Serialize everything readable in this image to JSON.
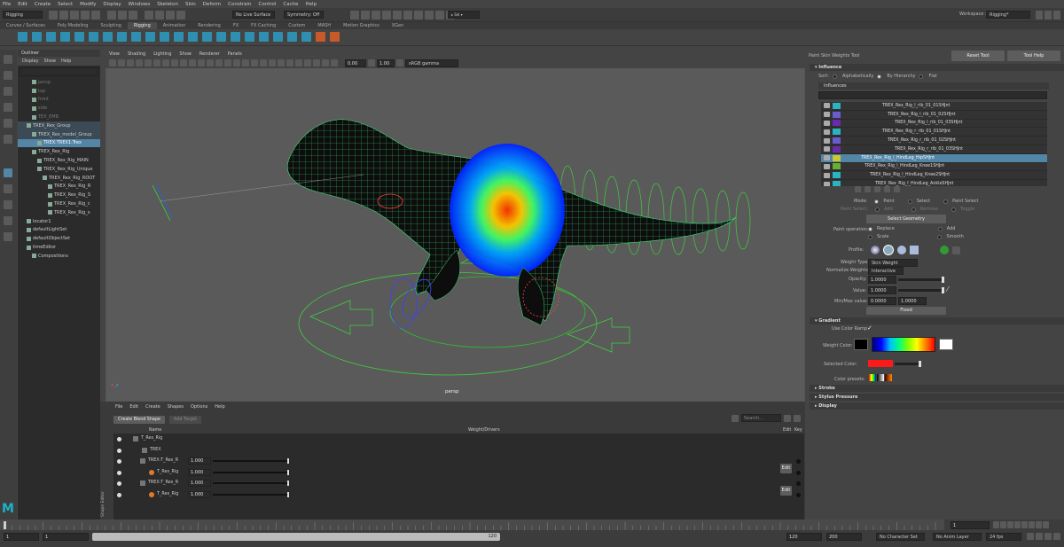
{
  "menu": [
    "File",
    "Edit",
    "Create",
    "Select",
    "Modify",
    "Display",
    "Windows",
    "Skeleton",
    "Skin",
    "Deform",
    "Constrain",
    "Control",
    "Cache",
    "Help"
  ],
  "status": {
    "mode": "Rigging",
    "live": "No Live Surface",
    "symmetry": "Symmetry: Off",
    "workspace_label": "Workspace :",
    "workspace": "Rigging*"
  },
  "shelf_tabs": [
    "Curves / Surfaces",
    "Poly Modeling",
    "Sculpting",
    "Rigging",
    "Animation",
    "Rendering",
    "FX",
    "FX Caching",
    "Custom",
    "MASH",
    "Motion Graphics",
    "XGen"
  ],
  "outliner": {
    "title": "Outliner",
    "menu": [
      "Display",
      "Show",
      "Help"
    ],
    "rows": [
      "persp",
      "top",
      "front",
      "side",
      "TEX_EMB",
      "TREX_Rex_Group",
      "TREX_Rex_model_Group",
      "TREX:TREX1:Trex",
      "TREX_Rex_Rig",
      "TREX_Rex_Rig_MAIN",
      "TREX_Rex_Rig_Unique",
      "TREX_Rex_Rig_ROOT",
      "TREX_Rex_Rig_R",
      "TREX_Rex_Rig_S",
      "TREX_Rex_Rig_c",
      "TREX_Rex_Rig_s",
      "locator1",
      "defaultLightSet",
      "defaultObjectSet",
      "timeEditor",
      "Compositions"
    ]
  },
  "viewport": {
    "menu": [
      "View",
      "Shading",
      "Lighting",
      "Show",
      "Renderer",
      "Panels"
    ],
    "exposure": "0.00",
    "gamma": "1.00",
    "colorspace": "sRGB gamma",
    "camera": "persp"
  },
  "shape_editor": {
    "side_title": "Shape Editor",
    "menu": [
      "File",
      "Edit",
      "Create",
      "Shapes",
      "Options",
      "Help"
    ],
    "create_btn": "Create Blend Shape",
    "add_target": "Add Target",
    "search": "Search...",
    "cols": {
      "name": "Name",
      "weight": "Weight/Drivers",
      "edit": "Edit",
      "key": "Key"
    },
    "rows": [
      {
        "name": "T_Rex_Rig"
      },
      {
        "name": "TREX"
      },
      {
        "name": "TREX:T_Rex_R",
        "value": "1.000"
      },
      {
        "name": "T_Rex_Rig",
        "value": "1.000"
      },
      {
        "name": "TREX:T_Rex_R",
        "value": "1.000"
      },
      {
        "name": "T_Rex_Rig",
        "value": "1.000"
      }
    ],
    "edit_label": "Edit"
  },
  "timeline": {
    "start": "1",
    "range_start": "1",
    "range_end": "120",
    "end": "120",
    "end2": "200",
    "char_set": "No Character Set",
    "anim_layer": "No Anim Layer",
    "fps": "24 fps",
    "current": "1"
  },
  "attr": {
    "title": "Paint Skin Weights Tool",
    "reset": "Reset Tool",
    "help": "Tool Help",
    "influence_section": "Influence",
    "sort_label": "Sort:",
    "sort_opts": [
      "Alphabetically",
      "By Hierarchy",
      "Flat"
    ],
    "influences_label": "Influences",
    "influences": [
      {
        "name": "TREX_Rex_Rig_l_rib_01_01SHJnt",
        "color": "#2ab3c0"
      },
      {
        "name": "TREX_Rex_Rig_l_rib_01_02SHJnt",
        "color": "#6a5ccc"
      },
      {
        "name": "TREX_Rex_Rig_l_rib_01_03SHJnt",
        "color": "#6a2ab0"
      },
      {
        "name": "TREX_Rex_Rig_r_rib_01_01SHJnt",
        "color": "#2ab3c0"
      },
      {
        "name": "TREX_Rex_Rig_r_rib_01_02SHJnt",
        "color": "#6a5ccc"
      },
      {
        "name": "TREX_Rex_Rig_r_rib_01_03SHJnt",
        "color": "#6a2ab0"
      },
      {
        "name": "TREX_Rex_Rig_l_HindLeg_HipSHJnt",
        "color": "#c8c830"
      },
      {
        "name": "TREX_Rex_Rig_l_HindLeg_Knee1SHJnt",
        "color": "#6ab030"
      },
      {
        "name": "TREX_Rex_Rig_l_HindLeg_Knee2SHJnt",
        "color": "#2ab3c0"
      },
      {
        "name": "TREX_Rex_Rig_l_HindLeg_AnkleSHJnt",
        "color": "#2ab3c0"
      }
    ],
    "mode_label": "Mode:",
    "modes": [
      "Paint",
      "Select",
      "Paint Select"
    ],
    "paint_select_label": "Paint Select:",
    "ps_opts": [
      "Add",
      "Remove",
      "Toggle"
    ],
    "select_geometry": "Select Geometry",
    "op_label": "Paint operation:",
    "ops": [
      "Replace",
      "Add",
      "Scale",
      "Smooth"
    ],
    "profile_label": "Profile:",
    "weight_type_label": "Weight Type:",
    "weight_type": "Skin Weight",
    "normalize_label": "Normalize Weights:",
    "normalize": "Interactive",
    "opacity_label": "Opacity:",
    "opacity": "1.0000",
    "value_label": "Value:",
    "value": "1.0000",
    "minmax_label": "Min/Max value:",
    "min": "0.0000",
    "max": "1.0000",
    "flood": "Flood",
    "gradient": "Gradient",
    "use_ramp": "Use Color Ramp",
    "weight_color": "Weight Color:",
    "selected_color": "Selected Color:",
    "presets": "Color presets:",
    "stroke": "Stroke",
    "stylus": "Stylus Pressure",
    "display": "Display"
  }
}
